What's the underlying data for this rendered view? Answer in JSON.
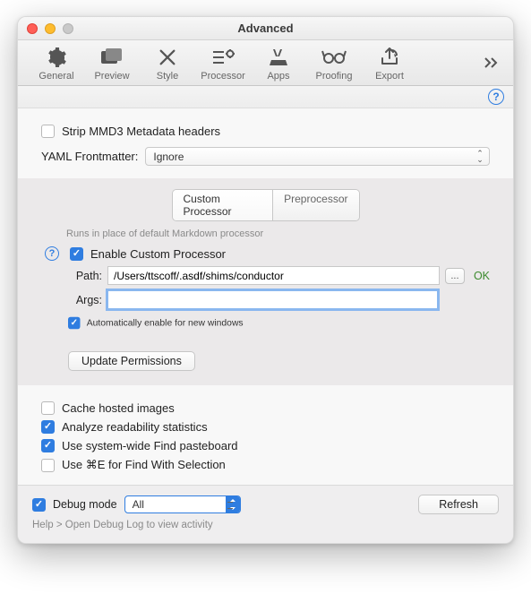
{
  "window": {
    "title": "Advanced"
  },
  "toolbar": {
    "items": [
      {
        "label": "General",
        "icon": "gear"
      },
      {
        "label": "Preview",
        "icon": "preview"
      },
      {
        "label": "Style",
        "icon": "style"
      },
      {
        "label": "Processor",
        "icon": "processor"
      },
      {
        "label": "Apps",
        "icon": "apps"
      },
      {
        "label": "Proofing",
        "icon": "glasses"
      },
      {
        "label": "Export",
        "icon": "export"
      }
    ]
  },
  "section1": {
    "strip_label": "Strip MMD3 Metadata headers",
    "yaml_label": "YAML Frontmatter:",
    "yaml_value": "Ignore"
  },
  "processor": {
    "tabs": {
      "custom": "Custom Processor",
      "pre": "Preprocessor"
    },
    "hint": "Runs in place of default Markdown processor",
    "enable_label": "Enable Custom Processor",
    "path_label": "Path:",
    "path_value": "/Users/ttscoff/.asdf/shims/conductor",
    "browse": "...",
    "ok": "OK",
    "args_label": "Args:",
    "args_value": "",
    "auto_label": "Automatically enable for new windows",
    "update_btn": "Update Permissions"
  },
  "options": {
    "cache": "Cache hosted images",
    "readability": "Analyze readability statistics",
    "findpb": "Use system-wide Find pasteboard",
    "cmde": "Use ⌘E for Find With Selection"
  },
  "footer": {
    "debug_label": "Debug mode",
    "debug_filter": "All",
    "refresh": "Refresh",
    "note": "Help > Open Debug Log to view activity"
  }
}
